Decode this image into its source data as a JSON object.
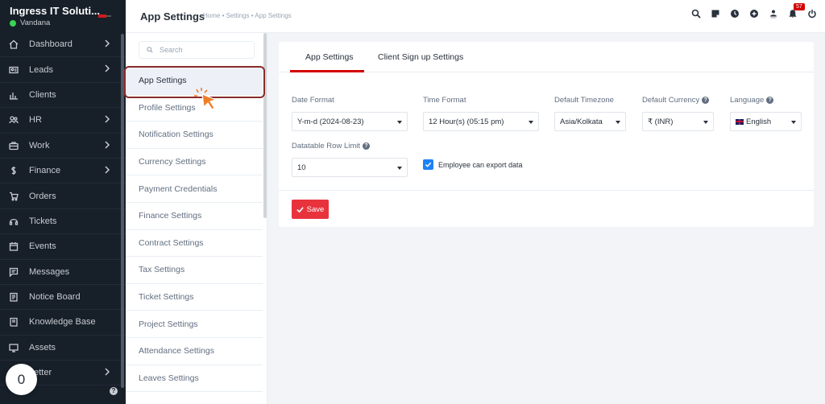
{
  "sidebar": {
    "company": "Ingress IT Soluti...",
    "user": "Vandana",
    "help_glyph": "?",
    "items": [
      {
        "label": "Dashboard",
        "icon": "home-icon",
        "has_arrow": true
      },
      {
        "label": "Leads",
        "icon": "leads-icon",
        "has_arrow": true
      },
      {
        "label": "Clients",
        "icon": "clients-icon",
        "has_arrow": false
      },
      {
        "label": "HR",
        "icon": "hr-icon",
        "has_arrow": true
      },
      {
        "label": "Work",
        "icon": "work-icon",
        "has_arrow": true
      },
      {
        "label": "Finance",
        "icon": "finance-icon",
        "has_arrow": true
      },
      {
        "label": "Orders",
        "icon": "cart-icon",
        "has_arrow": false
      },
      {
        "label": "Tickets",
        "icon": "headset-icon",
        "has_arrow": false
      },
      {
        "label": "Events",
        "icon": "calendar-icon",
        "has_arrow": false
      },
      {
        "label": "Messages",
        "icon": "messages-icon",
        "has_arrow": false
      },
      {
        "label": "Notice Board",
        "icon": "notice-icon",
        "has_arrow": false
      },
      {
        "label": "Knowledge Base",
        "icon": "book-icon",
        "has_arrow": false
      },
      {
        "label": "Assets",
        "icon": "monitor-icon",
        "has_arrow": false
      },
      {
        "label": "Letter",
        "icon": "letter-icon",
        "has_arrow": true
      }
    ]
  },
  "overlay_badge": "0",
  "header": {
    "title": "App Settings",
    "breadcrumb": "Home • Settings • App Settings",
    "notification_count": "57"
  },
  "settings_menu": {
    "search_placeholder": "Search",
    "items": [
      "App Settings",
      "Profile Settings",
      "Notification Settings",
      "Currency Settings",
      "Payment Credentials",
      "Finance Settings",
      "Contract Settings",
      "Tax Settings",
      "Ticket Settings",
      "Project Settings",
      "Attendance Settings",
      "Leaves Settings"
    ]
  },
  "tabs": [
    "App Settings",
    "Client Sign up Settings"
  ],
  "form": {
    "date_format": {
      "label": "Date Format",
      "value": "Y-m-d (2024-08-23)"
    },
    "time_format": {
      "label": "Time Format",
      "value": "12 Hour(s) (05:15 pm)"
    },
    "timezone": {
      "label": "Default Timezone",
      "value": "Asia/Kolkata"
    },
    "currency": {
      "label": "Default Currency",
      "value": "₹ (INR)"
    },
    "language": {
      "label": "Language",
      "value": "English"
    },
    "row_limit": {
      "label": "Datatable Row Limit",
      "value": "10"
    },
    "export_checkbox": {
      "label": "Employee can export data",
      "checked": true
    },
    "help_glyph": "?"
  },
  "save_label": "Save",
  "colors": {
    "accent": "#d30000",
    "save": "#e8333d",
    "checkbox": "#1d82f5",
    "sidebar": "#171f29"
  }
}
